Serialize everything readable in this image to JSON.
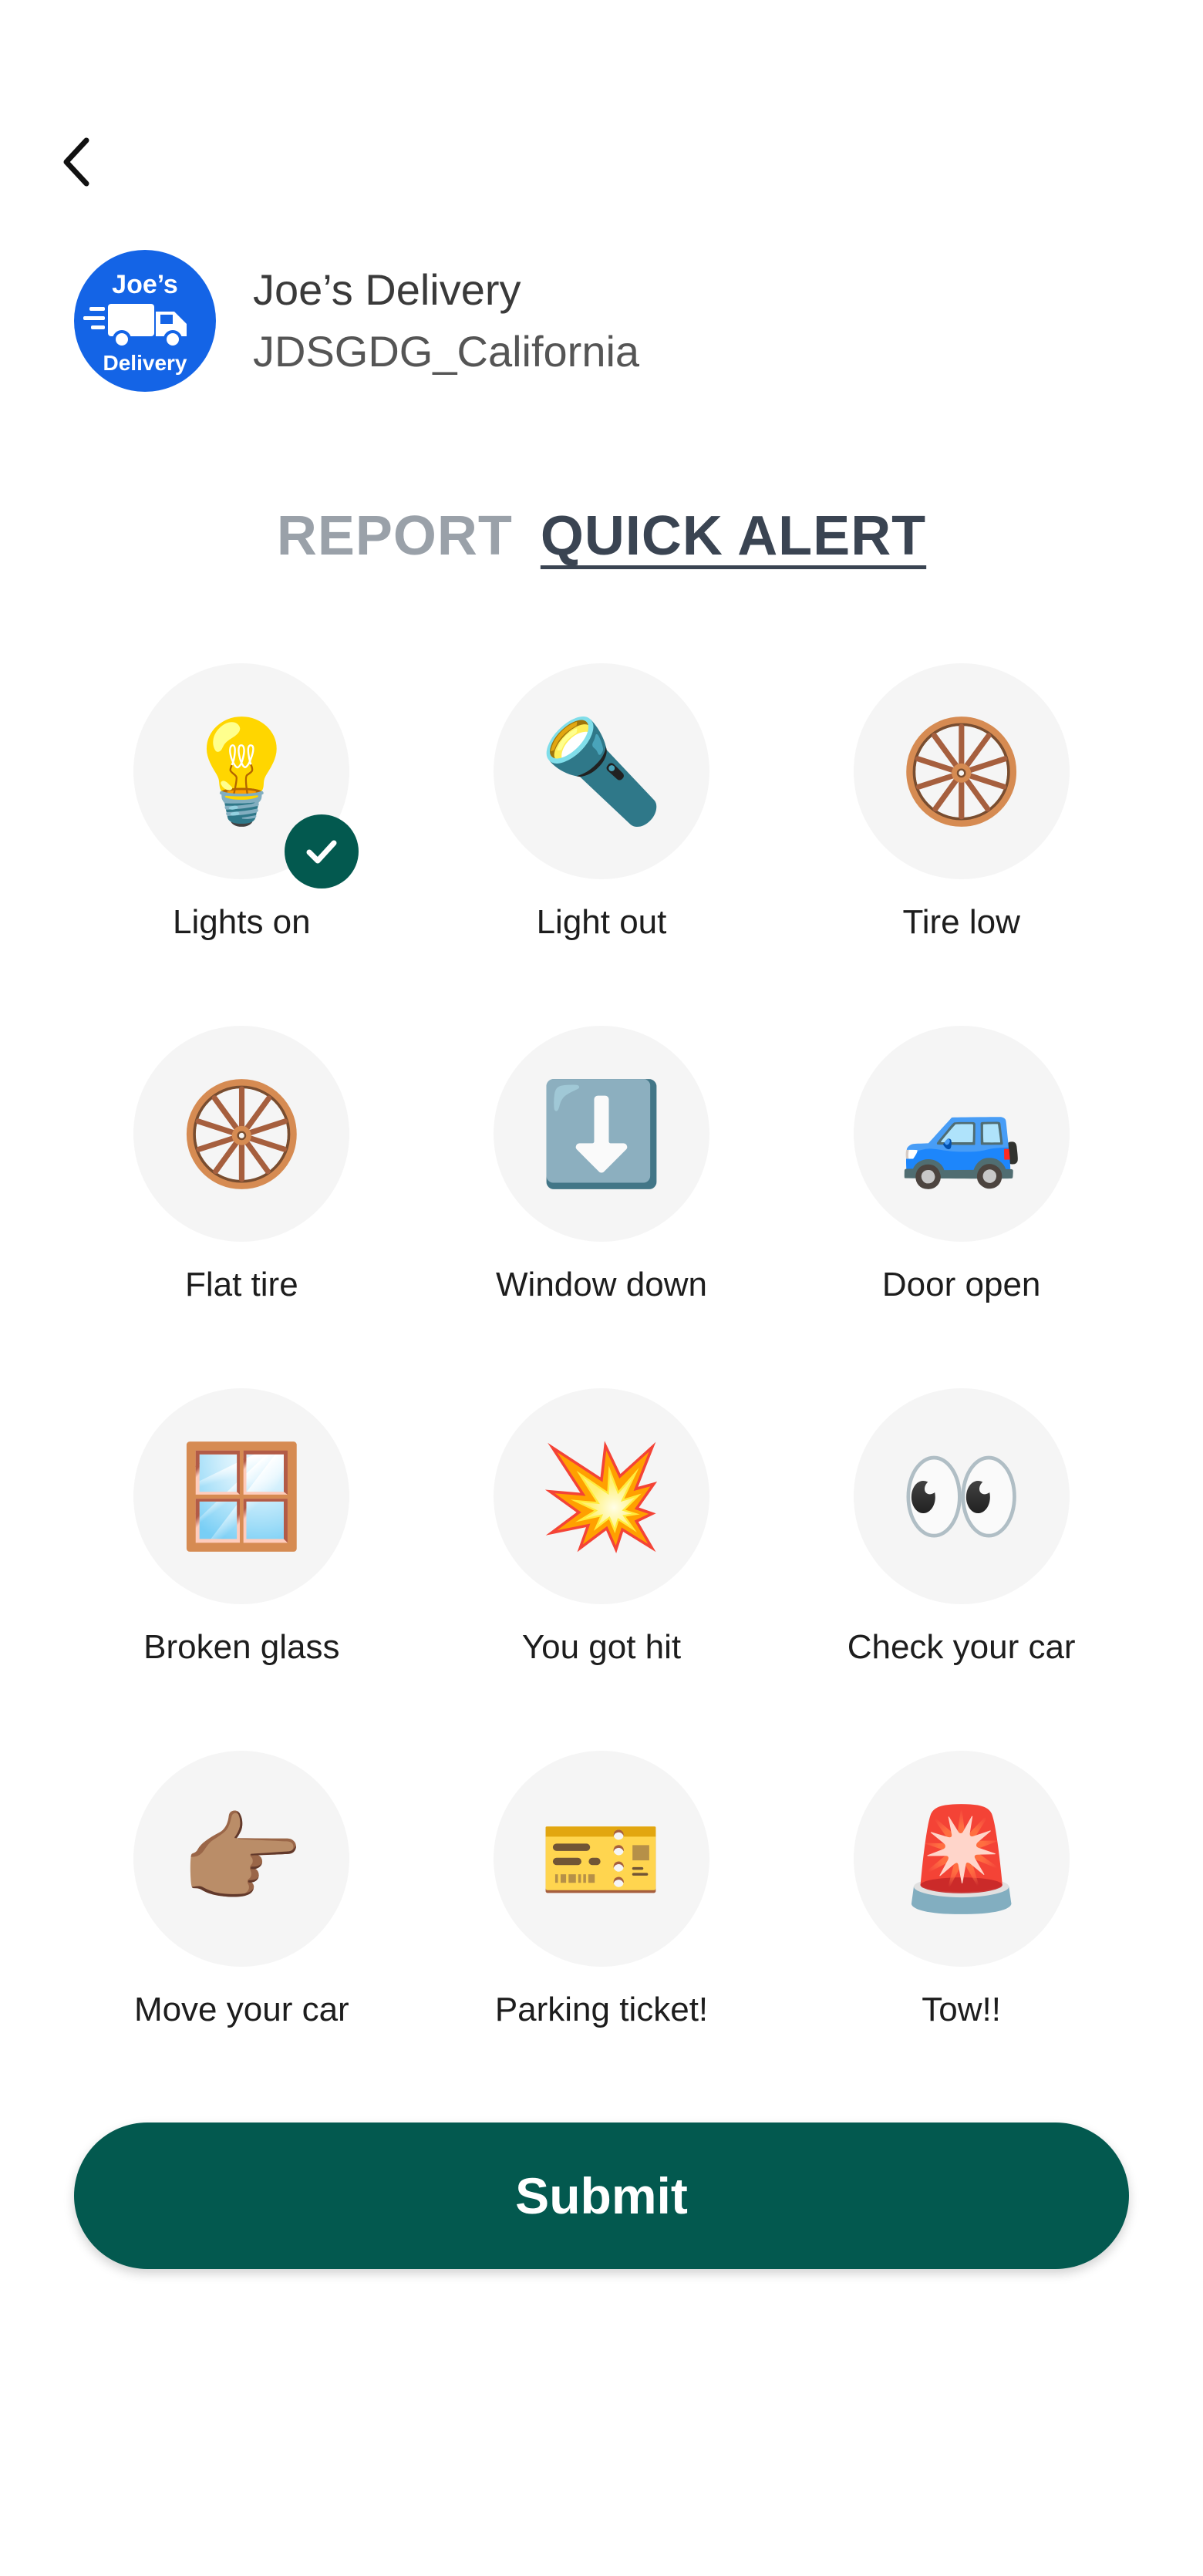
{
  "header": {
    "back_icon": "chevron-left-icon"
  },
  "profile": {
    "logo_line1": "Joe’s",
    "logo_line2": "Delivery",
    "company_name": "Joe’s Delivery",
    "company_id": "JDSGDG_California",
    "logo_color": "#1464e6"
  },
  "tabs": {
    "report": "REPORT",
    "quick_alert": "QUICK ALERT",
    "active": "quick_alert"
  },
  "alerts": [
    {
      "label": "Lights on",
      "emoji": "💡",
      "icon": "light-bulb-icon",
      "selected": true
    },
    {
      "label": "Light out",
      "emoji": "🔦",
      "icon": "flashlight-icon",
      "selected": false
    },
    {
      "label": "Tire low",
      "emoji": "🛞",
      "icon": "tire-icon",
      "selected": false
    },
    {
      "label": "Flat tire",
      "emoji": "🛞",
      "icon": "tire-icon",
      "selected": false
    },
    {
      "label": "Window down",
      "emoji": "⬇️",
      "icon": "down-arrow-icon",
      "selected": false
    },
    {
      "label": "Door open",
      "emoji": "🚙",
      "icon": "car-icon",
      "selected": false
    },
    {
      "label": "Broken glass",
      "emoji": "🪟",
      "icon": "window-icon",
      "selected": false
    },
    {
      "label": "You got hit",
      "emoji": "💥",
      "icon": "collision-icon",
      "selected": false
    },
    {
      "label": "Check your car",
      "emoji": "👀",
      "icon": "eyes-icon",
      "selected": false
    },
    {
      "label": "Move your car",
      "emoji": "👉🏽",
      "icon": "pointing-hand-icon",
      "selected": false
    },
    {
      "label": "Parking ticket!",
      "emoji": "🎫",
      "icon": "ticket-icon",
      "selected": false
    },
    {
      "label": "Tow!!",
      "emoji": "🚨",
      "icon": "siren-icon",
      "selected": false
    }
  ],
  "submit": {
    "label": "Submit"
  },
  "colors": {
    "primary": "#03594f",
    "tab_active": "#3a4452",
    "tab_inactive": "#9aa1a9",
    "circle_bg": "#f5f5f5"
  }
}
